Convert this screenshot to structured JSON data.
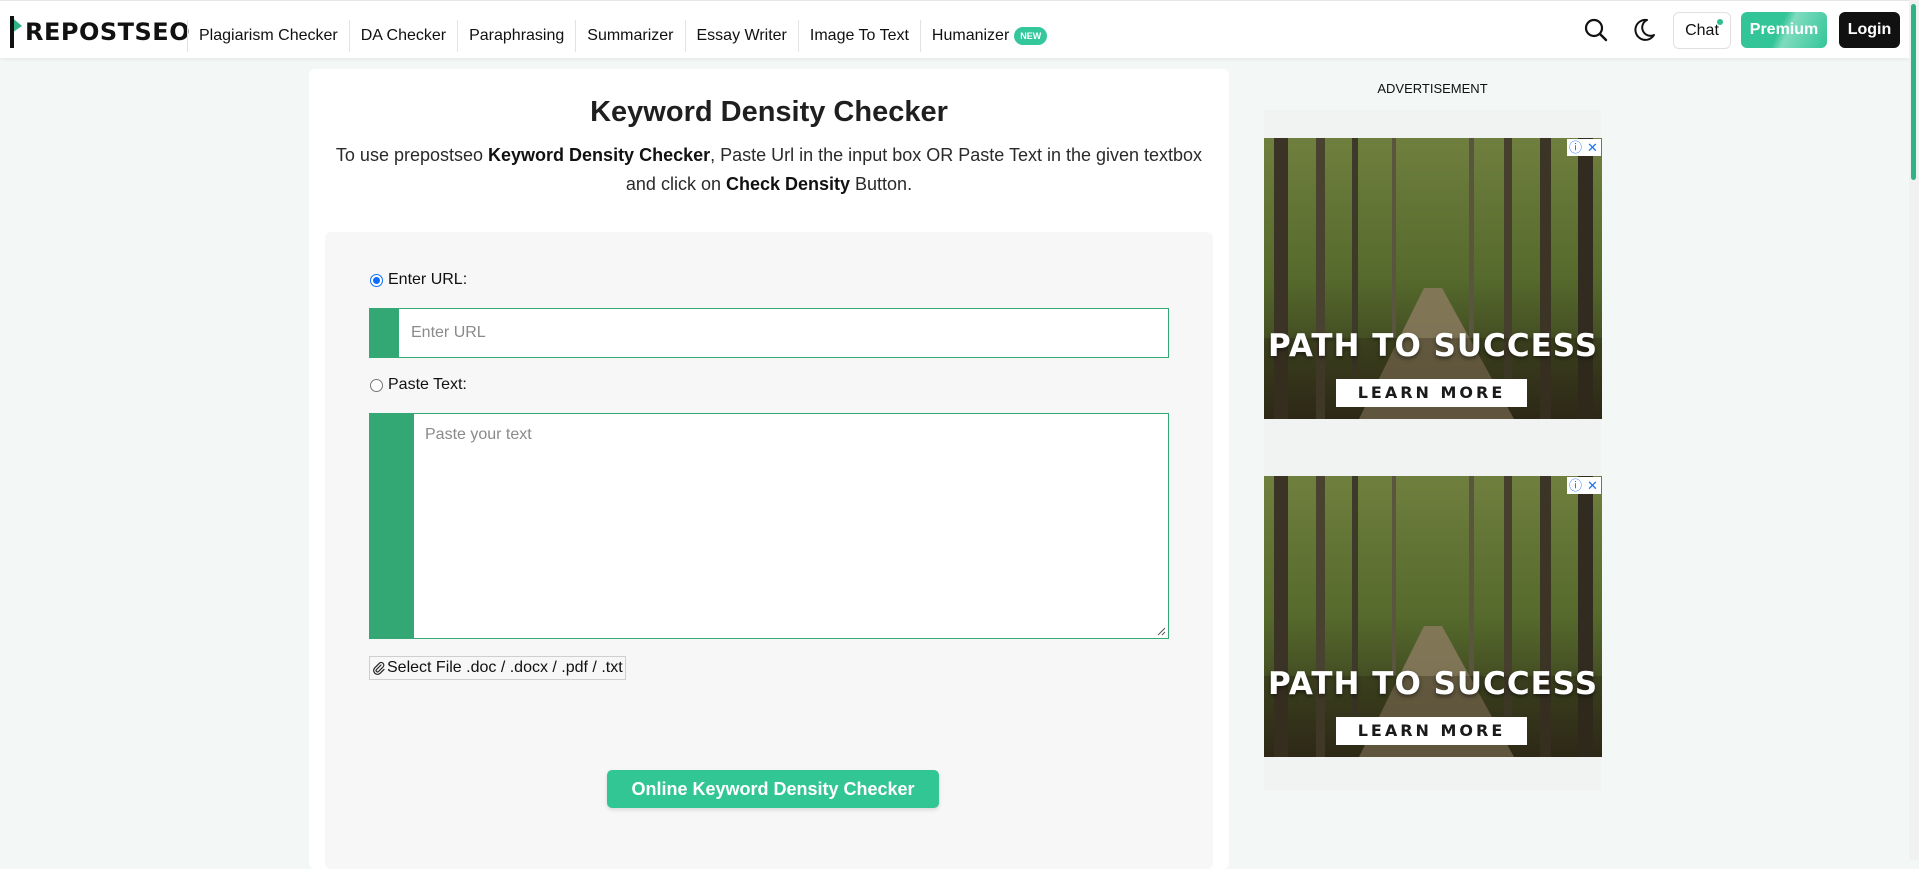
{
  "header": {
    "logo_text": "REPOSTSEO",
    "logo_icon": "prepostseo-logo-mark",
    "nav": [
      {
        "label": "Plagiarism Checker"
      },
      {
        "label": "DA Checker"
      },
      {
        "label": "Paraphrasing"
      },
      {
        "label": "Summarizer"
      },
      {
        "label": "Essay Writer"
      },
      {
        "label": "Image To Text"
      },
      {
        "label": "Humanizer",
        "badge": "NEW"
      }
    ],
    "search_icon": "search-icon",
    "theme_icon": "moon-icon",
    "chat_label": "Chat",
    "premium_label": "Premium",
    "login_label": "Login"
  },
  "main": {
    "title": "Keyword Density Checker",
    "intro": {
      "p1": "To use prepostseo ",
      "b1": "Keyword Density Checker",
      "p2": ", Paste Url in the input box OR Paste Text in the given textbox and click on ",
      "b2": "Check Density",
      "p3": " Button."
    },
    "url_option_label": "Enter URL:",
    "url_placeholder": "Enter URL",
    "text_option_label": "Paste Text:",
    "text_placeholder": "Paste your text",
    "file_button_label": "Select File .doc / .docx / .pdf / .txt",
    "submit_label": "Online Keyword Density Checker",
    "selected_option": "url"
  },
  "sidebar": {
    "ad_label": "ADVERTISEMENT",
    "ads": [
      {
        "headline": "PATH TO SUCCESS",
        "cta": "LEARN MORE"
      },
      {
        "headline": "PATH TO SUCCESS",
        "cta": "LEARN MORE"
      }
    ],
    "ad_info_icon": "ⓘ",
    "ad_close_icon": "✕"
  },
  "colors": {
    "brand_green": "#33c597",
    "input_green": "#34a874",
    "radio_blue": "#0d6efd"
  }
}
